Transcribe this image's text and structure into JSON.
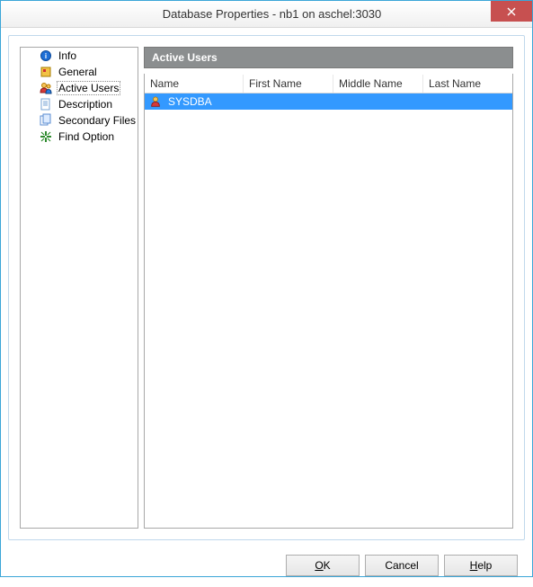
{
  "window": {
    "title": "Database Properties - nb1 on aschel:3030"
  },
  "sidebar": {
    "items": [
      {
        "label": "Info",
        "icon": "info-icon"
      },
      {
        "label": "General",
        "icon": "general-icon"
      },
      {
        "label": "Active Users",
        "icon": "users-icon",
        "selected": true
      },
      {
        "label": "Description",
        "icon": "description-icon"
      },
      {
        "label": "Secondary Files",
        "icon": "files-icon"
      },
      {
        "label": "Find Option",
        "icon": "find-icon"
      }
    ]
  },
  "panel": {
    "title": "Active Users"
  },
  "table": {
    "columns": {
      "name": "Name",
      "first": "First Name",
      "middle": "Middle Name",
      "last": "Last Name"
    },
    "rows": [
      {
        "name": "SYSDBA",
        "first": "",
        "middle": "",
        "last": "",
        "selected": true
      }
    ]
  },
  "buttons": {
    "ok": "OK",
    "cancel": "Cancel",
    "help": "Help"
  }
}
